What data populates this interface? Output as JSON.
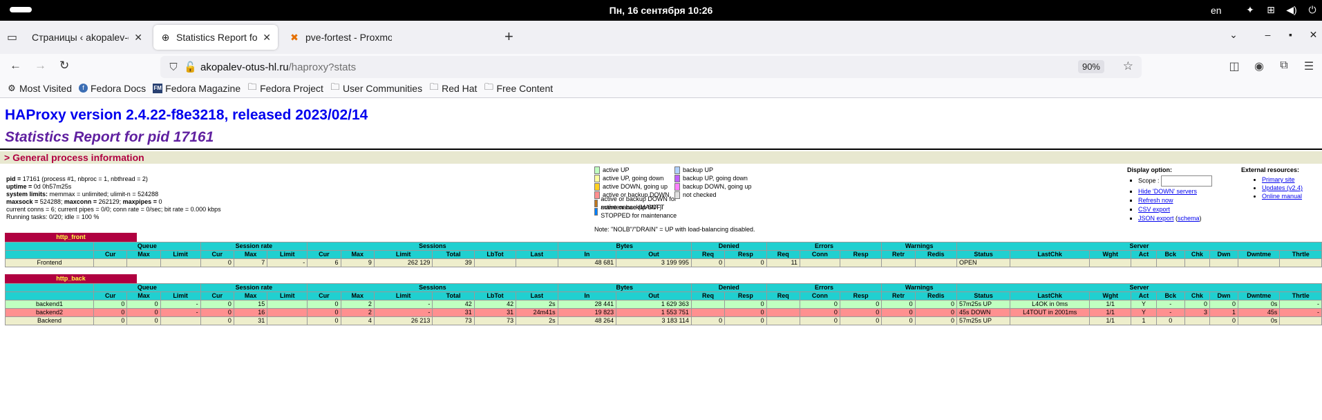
{
  "system_bar": {
    "clock": "Пн, 16 сентября  10:26",
    "lang": "en"
  },
  "browser": {
    "tabs": [
      {
        "title": "Страницы ‹ akopalev-otus-hl",
        "active": false
      },
      {
        "title": "Statistics Report for HAPr",
        "active": true
      },
      {
        "title": "pve-fortest - Proxmox Vir",
        "active": false
      }
    ],
    "url_host": "akopalev-otus-hl.ru",
    "url_path": "/haproxy?stats",
    "zoom": "90%",
    "bookmarks": [
      "Most Visited",
      "Fedora Docs",
      "Fedora Magazine",
      "Fedora Project",
      "User Communities",
      "Red Hat",
      "Free Content"
    ]
  },
  "page": {
    "title": "HAProxy version 2.4.22-f8e3218, released 2023/02/14",
    "subtitle": "Statistics Report for pid 17161",
    "section": "> General process information",
    "proc_info": {
      "pid_label": "pid = ",
      "pid_value": "17161 (process #1, nbproc = 1, nbthread = 2)",
      "uptime_label": "uptime = ",
      "uptime_value": "0d 0h57m25s",
      "syslimits_label": "system limits:",
      "syslimits_value": " memmax = unlimited; ulimit-n = 524288",
      "maxsock_label": "maxsock = ",
      "maxsock_value": "524288; ",
      "maxconn_label": "maxconn = ",
      "maxconn_value": "262129; ",
      "maxpipes_label": "maxpipes = ",
      "maxpipes_value": "0",
      "current": "current conns = 6; current pipes = 0/0; conn rate = 0/sec; bit rate = 0.000 kbps",
      "running": "Running tasks: 0/20; idle = 100 %"
    },
    "legend_col1": [
      {
        "label": "active UP",
        "color": "#c0ffc0"
      },
      {
        "label": "active UP, going down",
        "color": "#ffffa0"
      },
      {
        "label": "active DOWN, going up",
        "color": "#ffd020"
      },
      {
        "label": "active or backup DOWN",
        "color": "#ff9090"
      },
      {
        "label": "active or backup DOWN for maintenance (MAINT)",
        "color": "#c07820"
      },
      {
        "label": "active or backup SOFT STOPPED for maintenance",
        "color": "#0080ff"
      }
    ],
    "legend_col2": [
      {
        "label": "backup UP",
        "color": "#b0d0ff"
      },
      {
        "label": "backup UP, going down",
        "color": "#c060ff"
      },
      {
        "label": "backup DOWN, going up",
        "color": "#ff80ff"
      },
      {
        "label": "not checked",
        "color": "#e0e0e0"
      }
    ],
    "legend_note": "Note: \"NOLB\"/\"DRAIN\" = UP with load-balancing disabled.",
    "display_option": {
      "head": "Display option:",
      "scope_label": "Scope : ",
      "links": [
        "Hide 'DOWN' servers",
        "Refresh now",
        "CSV export"
      ],
      "json_export": "JSON export",
      "schema": "schema"
    },
    "external": {
      "head": "External resources:",
      "links": [
        "Primary site",
        "Updates (v2.4)",
        "Online manual"
      ]
    }
  },
  "http_front": {
    "name": "http_front",
    "group_headers": [
      "",
      "Queue",
      "Session rate",
      "Sessions",
      "Bytes",
      "Denied",
      "Errors",
      "Warnings",
      "Server"
    ],
    "col_headers": [
      "",
      "Cur",
      "Max",
      "Limit",
      "Cur",
      "Max",
      "Limit",
      "Cur",
      "Max",
      "Limit",
      "Total",
      "LbTot",
      "Last",
      "In",
      "Out",
      "Req",
      "Resp",
      "Req",
      "Conn",
      "Resp",
      "Retr",
      "Redis",
      "Status",
      "LastChk",
      "Wght",
      "Act",
      "Bck",
      "Chk",
      "Dwn",
      "Dwntme",
      "Thrtle"
    ],
    "rows": [
      {
        "cls": "frontend",
        "cells": [
          "Frontend",
          "",
          "",
          "",
          "0",
          "7",
          "-",
          "6",
          "9",
          "262 129",
          "39",
          "",
          "",
          "48 681",
          "3 199 995",
          "0",
          "0",
          "11",
          "",
          "",
          "",
          "",
          "OPEN",
          "",
          "",
          "",
          "",
          "",
          "",
          "",
          ""
        ]
      }
    ]
  },
  "http_back": {
    "name": "http_back",
    "group_headers": [
      "",
      "Queue",
      "Session rate",
      "Sessions",
      "Bytes",
      "Denied",
      "Errors",
      "Warnings",
      "Server"
    ],
    "col_headers": [
      "",
      "Cur",
      "Max",
      "Limit",
      "Cur",
      "Max",
      "Limit",
      "Cur",
      "Max",
      "Limit",
      "Total",
      "LbTot",
      "Last",
      "In",
      "Out",
      "Req",
      "Resp",
      "Req",
      "Conn",
      "Resp",
      "Retr",
      "Redis",
      "Status",
      "LastChk",
      "Wght",
      "Act",
      "Bck",
      "Chk",
      "Dwn",
      "Dwntme",
      "Thrtle"
    ],
    "rows": [
      {
        "cls": "up",
        "cells": [
          "backend1",
          "0",
          "0",
          "-",
          "0",
          "15",
          "",
          "0",
          "2",
          "-",
          "42",
          "42",
          "2s",
          "28 441",
          "1 629 363",
          "",
          "0",
          "",
          "0",
          "0",
          "0",
          "0",
          "57m25s UP",
          "L4OK in 0ms",
          "1/1",
          "Y",
          "-",
          "0",
          "0",
          "0s",
          "-"
        ]
      },
      {
        "cls": "down",
        "cells": [
          "backend2",
          "0",
          "0",
          "-",
          "0",
          "16",
          "",
          "0",
          "2",
          "-",
          "31",
          "31",
          "24m41s",
          "19 823",
          "1 553 751",
          "",
          "0",
          "",
          "0",
          "0",
          "0",
          "0",
          "45s DOWN",
          "L4TOUT in 2001ms",
          "1/1",
          "Y",
          "-",
          "3",
          "1",
          "45s",
          "-"
        ]
      },
      {
        "cls": "backend",
        "cells": [
          "Backend",
          "0",
          "0",
          "",
          "0",
          "31",
          "",
          "0",
          "4",
          "26 213",
          "73",
          "73",
          "2s",
          "48 264",
          "3 183 114",
          "0",
          "0",
          "",
          "0",
          "0",
          "0",
          "0",
          "57m25s UP",
          "",
          "1/1",
          "1",
          "0",
          "",
          "0",
          "0s",
          ""
        ]
      }
    ]
  }
}
